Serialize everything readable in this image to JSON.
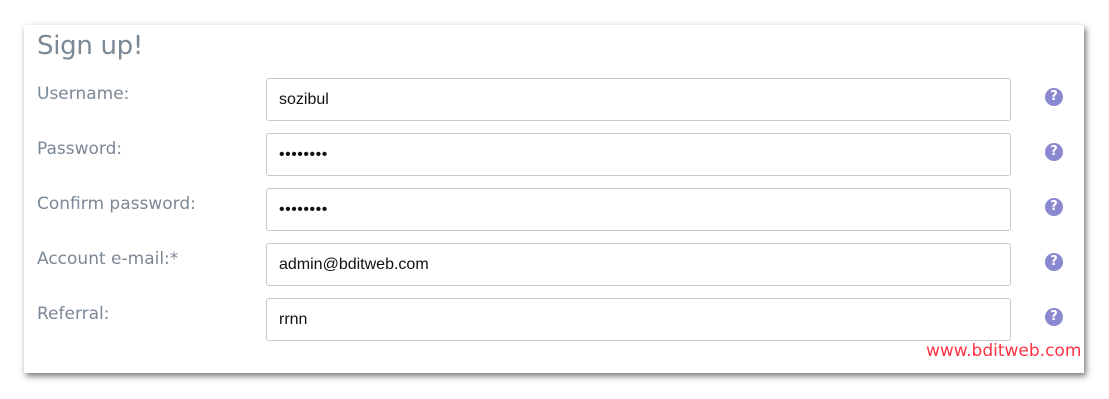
{
  "form": {
    "title": "Sign up!",
    "fields": [
      {
        "label": "Username:",
        "value": "sozibul",
        "type": "text"
      },
      {
        "label": "Password:",
        "value": "••••••••",
        "type": "password"
      },
      {
        "label": "Confirm password:",
        "value": "••••••••",
        "type": "password"
      },
      {
        "label": "Account e-mail:*",
        "value": "admin@bditweb.com",
        "type": "text"
      },
      {
        "label": "Referral:",
        "value": "rrnn",
        "type": "text"
      }
    ],
    "help_glyph": "?"
  },
  "watermark": "www.bditweb.com",
  "colors": {
    "label": "#7b8896",
    "help_icon": "#8a88d0",
    "watermark": "#ff3344"
  }
}
